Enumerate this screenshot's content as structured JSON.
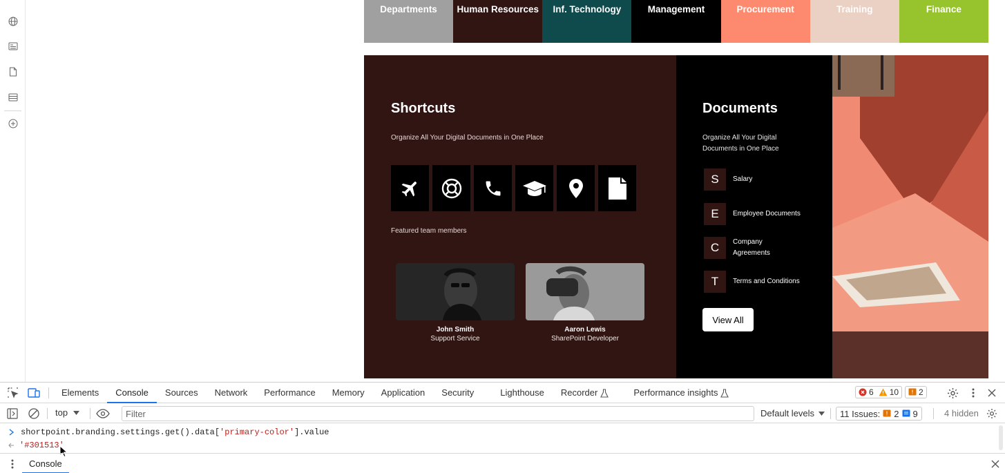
{
  "categories": [
    {
      "label": "Departments",
      "color": "#a0a0a0"
    },
    {
      "label": "Human Resources",
      "color": "#301513"
    },
    {
      "label": "Inf. Technology",
      "color": "#0f4a4c"
    },
    {
      "label": "Management",
      "color": "#000000"
    },
    {
      "label": "Procurement",
      "color": "#fd8a6e"
    },
    {
      "label": "Training",
      "color": "#ebd1c4"
    },
    {
      "label": "Finance",
      "color": "#97c42d"
    }
  ],
  "shortcuts": {
    "title": "Shortcuts",
    "subtitle": "Organize All Your Digital Documents in One Place",
    "icons": [
      "airplane-icon",
      "lifebuoy-icon",
      "phone-icon",
      "graduation-cap-icon",
      "map-pin-icon",
      "file-icon"
    ],
    "featured_label": "Featured team members",
    "members": [
      {
        "name": "John Smith",
        "role": "Support Service"
      },
      {
        "name": "Aaron Lewis",
        "role": "SharePoint Developer"
      }
    ]
  },
  "documents": {
    "title": "Documents",
    "subtitle": "Organize All Your Digital Documents in One Place",
    "items": [
      {
        "letter": "S",
        "label": "Salary"
      },
      {
        "letter": "E",
        "label": "Employee Documents"
      },
      {
        "letter": "C",
        "label": "Company Agreements"
      },
      {
        "letter": "T",
        "label": "Terms and Conditions"
      }
    ],
    "view_all": "View All"
  },
  "devtools": {
    "tabs": [
      "Elements",
      "Console",
      "Sources",
      "Network",
      "Performance",
      "Memory",
      "Application",
      "Security",
      "Lighthouse",
      "Recorder",
      "Performance insights"
    ],
    "active_tab": "Console",
    "errors": "6",
    "warnings": "10",
    "info": "2",
    "context": "top",
    "filter_placeholder": "Filter",
    "levels": "Default levels",
    "issues_label": "11 Issues:",
    "issues_warn": "2",
    "issues_info": "9",
    "hidden": "4 hidden",
    "command_prefix": "shortpoint.branding.settings.get().data[",
    "command_key": "'primary-color'",
    "command_suffix": "].value",
    "result": "'#301513'",
    "drawer_tab": "Console"
  },
  "colors": {
    "primary": "#301513",
    "accent": "#1a73e8"
  }
}
